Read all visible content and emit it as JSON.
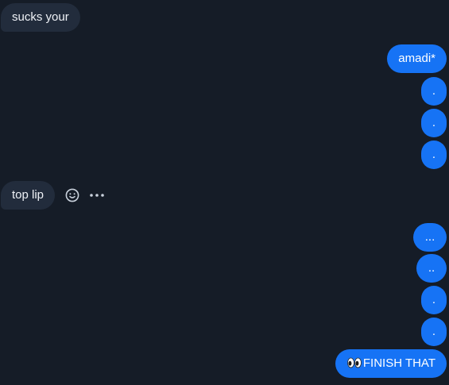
{
  "messages": {
    "m1": "sucks your",
    "m2": "amadi*",
    "m3": ".",
    "m4": ".",
    "m5": ".",
    "m6": "top lip",
    "m7": "...",
    "m8": "..",
    "m9": ".",
    "m10": ".",
    "m11": "FINISH THAT"
  },
  "icons": {
    "react": "smiley-icon",
    "more": "more-horizontal-icon",
    "eyes": "eyes-emoji"
  },
  "colors": {
    "background": "#151c27",
    "incoming_bubble": "#222c3c",
    "outgoing_bubble": "#1673f5",
    "icon": "#c9d1dc"
  }
}
